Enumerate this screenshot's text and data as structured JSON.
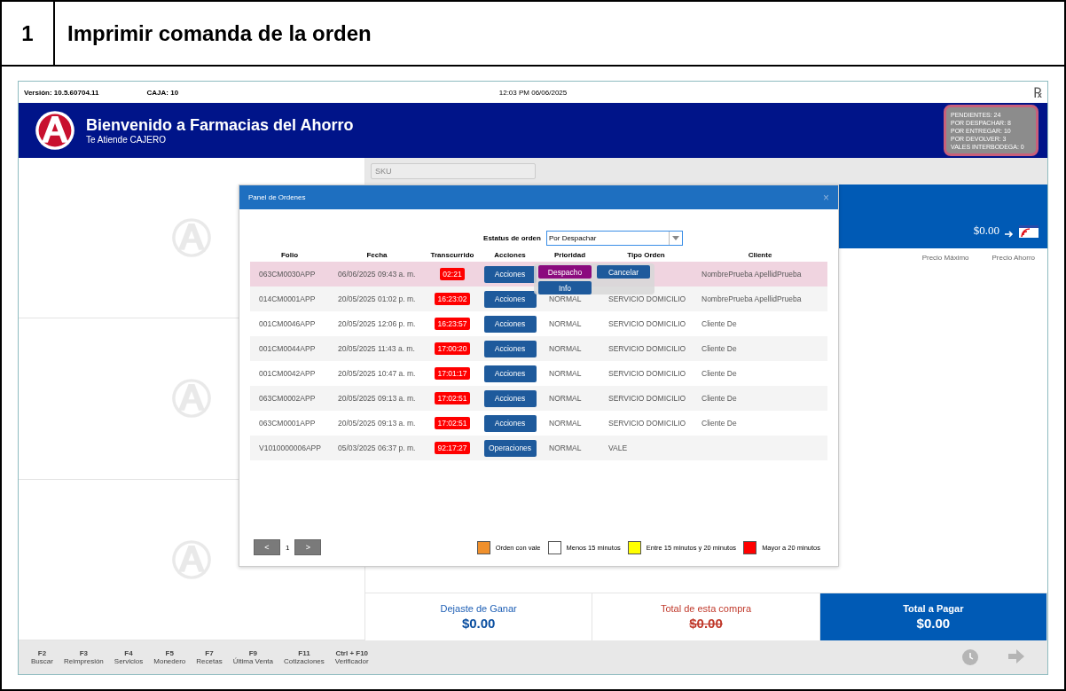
{
  "doc_header": {
    "step": "1",
    "title": "Imprimir comanda de la orden"
  },
  "topbar": {
    "version": "Versión: 10.5.60704.11",
    "caja": "CAJA: 10",
    "datetime": "12:03 PM  06/06/2025",
    "rx_symbol": "℞"
  },
  "header": {
    "title": "Bienvenido a Farmacias del Ahorro",
    "subtitle": "Te Atiende CAJERO",
    "status_lines": [
      "PENDIENTES: 24",
      "POR DESPACHAR: 8",
      "POR ENTREGAR: 10",
      "POR DEVOLVER: 3",
      "VALES INTERBODEGA: 0"
    ]
  },
  "sku": {
    "placeholder": "SKU"
  },
  "balance": {
    "amount": "$0.00"
  },
  "product_columns": [
    "Precio Máximo",
    "Precio Ahorro"
  ],
  "totals": [
    {
      "kind": "savings",
      "label": "Dejaste de Ganar",
      "amount": "$0.00"
    },
    {
      "kind": "struck",
      "label": "Total de esta compra",
      "amount": "$0.00"
    },
    {
      "kind": "total",
      "label": "Total a Pagar",
      "amount": "$0.00"
    }
  ],
  "function_keys": [
    {
      "key": "F2",
      "label": "Buscar"
    },
    {
      "key": "F3",
      "label": "Reimpresión"
    },
    {
      "key": "F4",
      "label": "Servicios"
    },
    {
      "key": "F5",
      "label": "Monedero"
    },
    {
      "key": "F7",
      "label": "Recetas"
    },
    {
      "key": "F9",
      "label": "Última Venta"
    },
    {
      "key": "F11",
      "label": "Cotizaciones"
    },
    {
      "key": "Ctrl + F10",
      "label": "Verificador"
    }
  ],
  "nav_buttons": [
    {
      "kind": "clock",
      "disabled": true
    },
    {
      "kind": "arrow",
      "disabled": true
    }
  ],
  "modal": {
    "title": "Panel de Ordenes",
    "close": "×",
    "filter_label": "Estatus de orden",
    "filter_value": "Por Despachar",
    "columns": [
      "Folio",
      "Fecha",
      "Transcurrido",
      "Acciones",
      "Prioridad",
      "Tipo Orden",
      "Cliente"
    ],
    "rows": [
      {
        "folio": "063CM0030APP",
        "fecha": "06/06/2025 09:43 a. m.",
        "elapsed": "02:21",
        "color": "#ff0000",
        "action": "Acciones",
        "client": "NombrePrueba ApellidPrueba",
        "selected": true
      },
      {
        "folio": "014CM0001APP",
        "fecha": "20/05/2025 01:02 p. m.",
        "elapsed": "16:23:02",
        "color": "#ff0000",
        "action": "Acciones",
        "priority": "NORMAL",
        "type": "SERVICIO DOMICILIO",
        "client": "NombrePrueba ApellidPrueba",
        "selected": false
      },
      {
        "folio": "001CM0046APP",
        "fecha": "20/05/2025 12:06 p. m.",
        "elapsed": "16:23:57",
        "color": "#ff0000",
        "action": "Acciones",
        "priority": "NORMAL",
        "type": "SERVICIO DOMICILIO",
        "client": "Cliente De",
        "selected": false
      },
      {
        "folio": "001CM0044APP",
        "fecha": "20/05/2025 11:43 a. m.",
        "elapsed": "17:00:20",
        "color": "#ff0000",
        "action": "Acciones",
        "priority": "NORMAL",
        "type": "SERVICIO DOMICILIO",
        "client": "Cliente De",
        "selected": false
      },
      {
        "folio": "001CM0042APP",
        "fecha": "20/05/2025 10:47 a. m.",
        "elapsed": "17:01:17",
        "color": "#ff0000",
        "action": "Acciones",
        "priority": "NORMAL",
        "type": "SERVICIO DOMICILIO",
        "client": "Cliente De",
        "selected": false
      },
      {
        "folio": "063CM0002APP",
        "fecha": "20/05/2025 09:13 a. m.",
        "elapsed": "17:02:51",
        "color": "#ff0000",
        "action": "Acciones",
        "priority": "NORMAL",
        "type": "SERVICIO DOMICILIO",
        "client": "Cliente De",
        "selected": false
      },
      {
        "folio": "063CM0001APP",
        "fecha": "20/05/2025 09:13 a. m.",
        "elapsed": "17:02:51",
        "color": "#ff0000",
        "action": "Acciones",
        "priority": "NORMAL",
        "type": "SERVICIO DOMICILIO",
        "client": "Cliente De",
        "selected": false
      },
      {
        "folio": "V1010000006APP",
        "fecha": "05/03/2025 06:37 p. m.",
        "elapsed": "92:17:27",
        "color": "#ff0000",
        "action": "Operaciones",
        "priority": "NORMAL",
        "type": "VALE",
        "selected": false
      }
    ],
    "popup_menu": [
      {
        "kind": "primary",
        "label": "Despacho"
      },
      {
        "kind": "secondary",
        "label": "Cancelar"
      },
      {
        "kind": "secondary",
        "label": "Info"
      }
    ],
    "pagination": {
      "prev": "<",
      "page": "1",
      "next": ">"
    },
    "legend": [
      {
        "label": "Orden con vale",
        "color": "#f0902c"
      },
      {
        "label": "Menos 15 minutos",
        "color": "#ffffff"
      },
      {
        "label": "Entre 15 minutos y 20 minutos",
        "color": "#ffff00"
      },
      {
        "label": "Mayor a 20 minutos",
        "color": "#ff0000"
      }
    ]
  }
}
